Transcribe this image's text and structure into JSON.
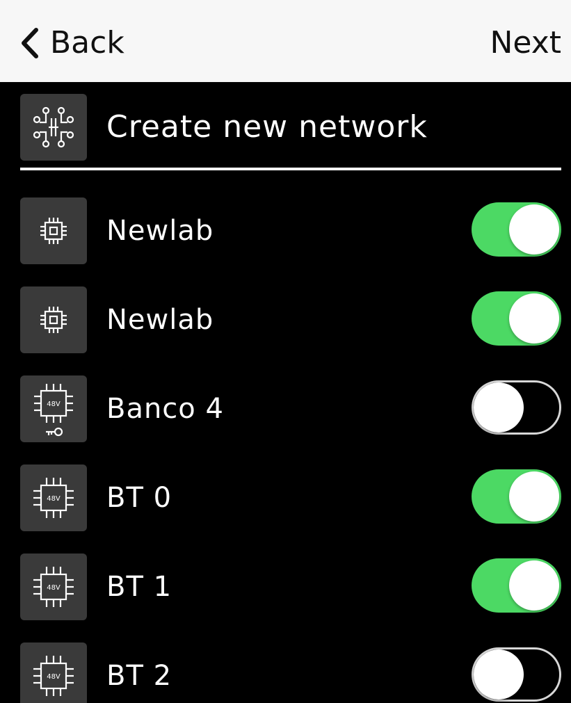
{
  "nav": {
    "back_label": "Back",
    "next_label": "Next"
  },
  "create": {
    "label": "Create new network",
    "icon": "network-tree-icon"
  },
  "networks": [
    {
      "label": "Newlab",
      "icon": "chip-icon",
      "enabled": true
    },
    {
      "label": "Newlab",
      "icon": "chip-icon",
      "enabled": true
    },
    {
      "label": "Banco 4",
      "icon": "chip-48v-key-icon",
      "badge": "48V",
      "enabled": false
    },
    {
      "label": "BT 0",
      "icon": "chip-48v-icon",
      "badge": "48V",
      "enabled": true
    },
    {
      "label": "BT 1",
      "icon": "chip-48v-icon",
      "badge": "48V",
      "enabled": true
    },
    {
      "label": "BT 2",
      "icon": "chip-48v-icon",
      "badge": "48V",
      "enabled": false
    }
  ],
  "colors": {
    "toggle_on": "#4cd964",
    "background": "#000000",
    "navbar": "#f7f7f7"
  }
}
